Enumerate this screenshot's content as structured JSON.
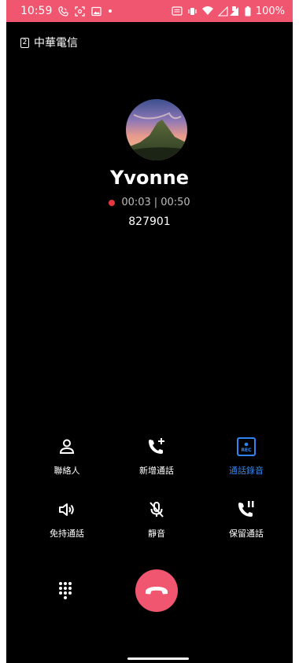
{
  "status_bar": {
    "time": "10:59",
    "battery": "100%"
  },
  "carrier": {
    "sim": "2",
    "name": "中華電信"
  },
  "caller": {
    "name": "Yvonne",
    "elapsed": "00:03",
    "separator": "|",
    "recording_time": "00:50",
    "number": "827901"
  },
  "controls": [
    {
      "label": "聯絡人",
      "icon": "contact-icon"
    },
    {
      "label": "新增通話",
      "icon": "add-call-icon"
    },
    {
      "label": "通話錄音",
      "icon": "record-icon",
      "active": true
    },
    {
      "label": "免持通話",
      "icon": "speaker-icon"
    },
    {
      "label": "靜音",
      "icon": "mute-icon"
    },
    {
      "label": "保留通話",
      "icon": "hold-icon"
    }
  ],
  "colors": {
    "status_bar": "#f0566f",
    "end_call": "#f0566f",
    "active": "#2f86f2",
    "recording_dot": "#e8383d"
  }
}
